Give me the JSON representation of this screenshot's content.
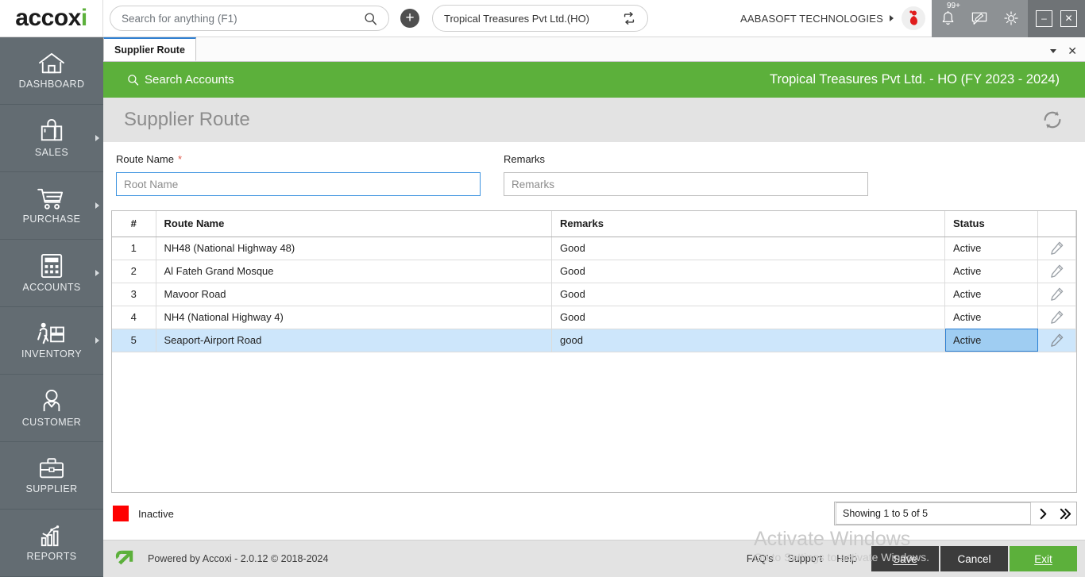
{
  "topbar": {
    "logo_text": "accox",
    "logo_accent": "i",
    "brand_green": "#5cb03b",
    "search": {
      "placeholder": "Search for anything (F1)",
      "value": ""
    },
    "add_button_label": "+",
    "branch_selector": {
      "value": "Tropical Treasures Pvt Ltd.(HO)"
    },
    "company_name": "AABASOFT TECHNOLOGIES",
    "notification_badge": "99+",
    "icons": [
      "search-icon",
      "plus-icon",
      "switch-branch-icon",
      "bell-icon",
      "message-icon",
      "gear-icon"
    ],
    "window_controls": {
      "minimize": "–",
      "close": "✕"
    }
  },
  "sidebar": {
    "items": [
      {
        "label": "DASHBOARD",
        "icon": "home-icon",
        "has_submenu": false
      },
      {
        "label": "SALES",
        "icon": "shopping-bag-icon",
        "has_submenu": true
      },
      {
        "label": "PURCHASE",
        "icon": "shopping-cart-icon",
        "has_submenu": true
      },
      {
        "label": "ACCOUNTS",
        "icon": "calculator-icon",
        "has_submenu": true
      },
      {
        "label": "INVENTORY",
        "icon": "warehouse-worker-icon",
        "has_submenu": true
      },
      {
        "label": "CUSTOMER",
        "icon": "person-icon",
        "has_submenu": false
      },
      {
        "label": "SUPPLIER",
        "icon": "briefcase-icon",
        "has_submenu": false
      },
      {
        "label": "REPORTS",
        "icon": "bar-chart-icon",
        "has_submenu": false
      }
    ]
  },
  "tabs": {
    "items": [
      {
        "label": "Supplier Route",
        "active": true
      }
    ],
    "caret": "▾",
    "close": "✕"
  },
  "greenbar": {
    "search_accounts_label": "Search Accounts",
    "fiscal_title": "Tropical Treasures Pvt Ltd. - HO (FY 2023 - 2024)",
    "color": "#5cb03b"
  },
  "page": {
    "title": "Supplier Route",
    "refresh_icon": "refresh-icon"
  },
  "form": {
    "route_name": {
      "label": "Route Name",
      "required_mark": "*",
      "placeholder": "Root Name",
      "value": ""
    },
    "remarks": {
      "label": "Remarks",
      "placeholder": "Remarks",
      "value": ""
    }
  },
  "grid": {
    "columns": [
      "#",
      "Route Name",
      "Remarks",
      "Status",
      ""
    ],
    "rows": [
      {
        "num": "1",
        "route_name": "NH48 (National Highway 48)",
        "remarks": "Good",
        "status": "Active",
        "selected": false
      },
      {
        "num": "2",
        "route_name": "Al Fateh Grand Mosque",
        "remarks": "Good",
        "status": "Active",
        "selected": false
      },
      {
        "num": "3",
        "route_name": "Mavoor Road",
        "remarks": "Good",
        "status": "Active",
        "selected": false
      },
      {
        "num": "4",
        "route_name": "NH4 (National Highway 4)",
        "remarks": "Good",
        "status": "Active",
        "selected": false
      },
      {
        "num": "5",
        "route_name": "Seaport-Airport Road",
        "remarks": "good",
        "status": "Active",
        "selected": true
      }
    ],
    "edit_icon": "pencil-icon"
  },
  "legend": {
    "inactive_label": "Inactive",
    "inactive_color": "#fe0000"
  },
  "pager": {
    "info": "Showing 1 to 5 of 5",
    "next_label": "❯",
    "last_label": "»"
  },
  "footer": {
    "powered_by": "Powered by Accoxi - 2.0.12 © 2018-2024",
    "links": [
      {
        "label": "FAQ's"
      },
      {
        "label": "Support"
      },
      {
        "label": "Help"
      }
    ],
    "buttons": [
      {
        "label": "Save",
        "accel": "S",
        "style": "dark"
      },
      {
        "label": "Cancel",
        "accel": "",
        "style": "dark"
      },
      {
        "label": "Exit",
        "accel": "E",
        "style": "green"
      }
    ]
  },
  "watermark": {
    "line1": "Activate Windows",
    "line2": "Go to Settings to activate Windows."
  }
}
